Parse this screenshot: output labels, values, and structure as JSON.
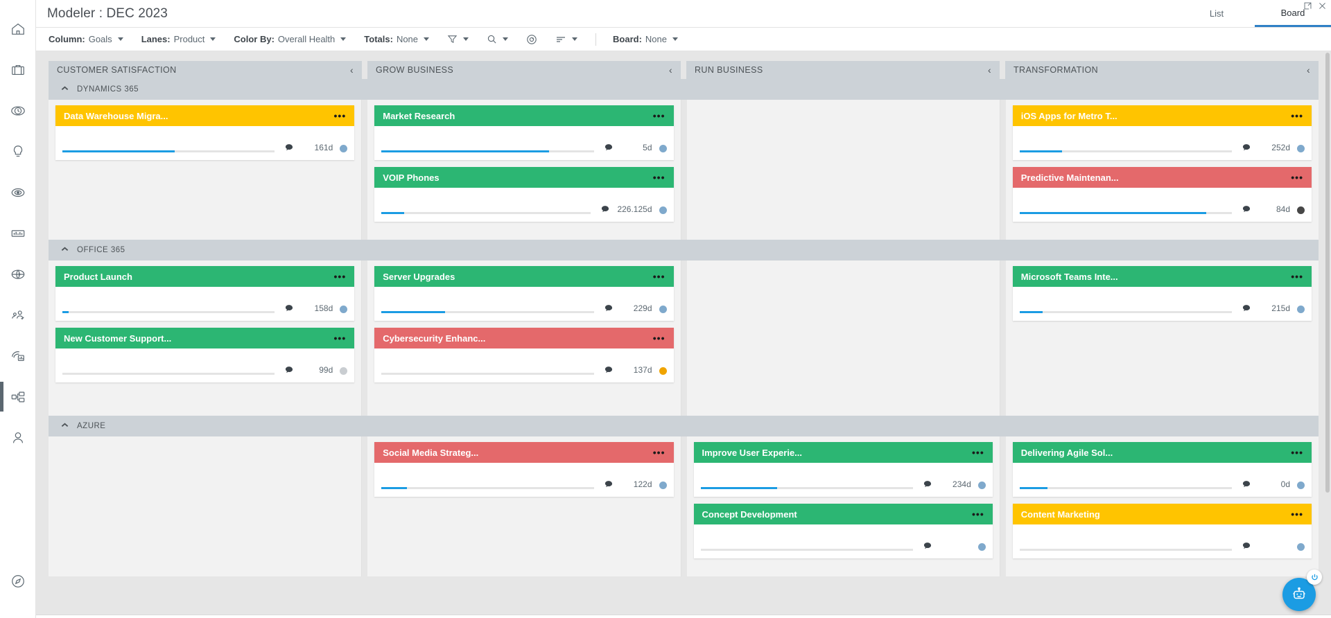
{
  "titlebar": {
    "app_title": "Modeler : DEC 2023",
    "tabs": [
      {
        "label": "List",
        "active": false
      },
      {
        "label": "Board",
        "active": true
      }
    ],
    "window_controls": [
      {
        "name": "restore-icon",
        "glyph": "❐"
      },
      {
        "name": "close-icon",
        "glyph": "✕"
      }
    ]
  },
  "toolbar": {
    "items": [
      {
        "label": "Column:",
        "value": "Goals",
        "name": "column-selector"
      },
      {
        "label": "Lanes:",
        "value": "Product",
        "name": "lanes-selector"
      },
      {
        "label": "Color By:",
        "value": "Overall Health",
        "name": "color-by-selector"
      },
      {
        "label": "Totals:",
        "value": "None",
        "name": "totals-selector"
      }
    ],
    "icon_items": [
      {
        "name": "filter-icon"
      },
      {
        "name": "search-icon"
      },
      {
        "name": "gauge-icon"
      },
      {
        "name": "sort-icon"
      }
    ],
    "board_item": {
      "label": "Board:",
      "value": "None",
      "name": "board-selector"
    }
  },
  "board": {
    "columns": [
      {
        "title": "CUSTOMER SATISFACTION"
      },
      {
        "title": "GROW BUSINESS"
      },
      {
        "title": "RUN BUSINESS"
      },
      {
        "title": "TRANSFORMATION"
      }
    ],
    "collapse_glyph": "‹",
    "lanes": [
      {
        "name": "DYNAMICS 365",
        "cells": [
          {
            "cards": [
              {
                "title": "Data Warehouse Migra...",
                "color": "#ffc400",
                "progress": 53,
                "days": "161d",
                "dot": "#7fa9cc"
              }
            ]
          },
          {
            "cards": [
              {
                "title": "Market Research",
                "color": "#2cb673",
                "progress": 79,
                "days": "5d",
                "dot": "#7fa9cc"
              },
              {
                "title": "VOIP Phones",
                "color": "#2cb673",
                "progress": 11,
                "days": "226.125d",
                "dot": "#7fa9cc"
              }
            ]
          },
          {
            "cards": []
          },
          {
            "cards": [
              {
                "title": "iOS Apps for Metro T...",
                "color": "#ffc400",
                "progress": 20,
                "days": "252d",
                "dot": "#7fa9cc"
              },
              {
                "title": "Predictive Maintenan...",
                "color": "#e4696b",
                "progress": 88,
                "days": "84d",
                "dot": "#474747"
              }
            ]
          }
        ]
      },
      {
        "name": "OFFICE 365",
        "cells": [
          {
            "cards": [
              {
                "title": "Product Launch",
                "color": "#2cb673",
                "progress": 3,
                "days": "158d",
                "dot": "#7fa9cc"
              },
              {
                "title": "New Customer Support...",
                "color": "#2cb673",
                "progress": 0,
                "days": "99d",
                "dot": "#c9cdd1"
              }
            ]
          },
          {
            "cards": [
              {
                "title": "Server Upgrades",
                "color": "#2cb673",
                "progress": 30,
                "days": "229d",
                "dot": "#7fa9cc"
              },
              {
                "title": "Cybersecurity Enhanc...",
                "color": "#e4696b",
                "progress": 0,
                "days": "137d",
                "dot": "#f0a400"
              }
            ]
          },
          {
            "cards": []
          },
          {
            "cards": [
              {
                "title": "Microsoft Teams Inte...",
                "color": "#2cb673",
                "progress": 11,
                "days": "215d",
                "dot": "#7fa9cc"
              }
            ]
          }
        ]
      },
      {
        "name": "AZURE",
        "cells": [
          {
            "cards": []
          },
          {
            "cards": [
              {
                "title": "Social Media Strateg...",
                "color": "#e4696b",
                "progress": 12,
                "days": "122d",
                "dot": "#7fa9cc"
              }
            ]
          },
          {
            "cards": [
              {
                "title": "Improve User Experie...",
                "color": "#2cb673",
                "progress": 36,
                "days": "234d",
                "dot": "#7fa9cc"
              },
              {
                "title": "Concept Development",
                "color": "#2cb673",
                "progress": 0,
                "days": "",
                "dot": "#7fa9cc"
              }
            ]
          },
          {
            "cards": [
              {
                "title": "Delivering Agile Sol...",
                "color": "#2cb673",
                "progress": 13,
                "days": "0d",
                "dot": "#7fa9cc"
              },
              {
                "title": "Content Marketing",
                "color": "#ffc400",
                "progress": 0,
                "days": "",
                "dot": "#7fa9cc"
              }
            ]
          }
        ]
      }
    ]
  },
  "rail": {
    "items": [
      {
        "name": "home-icon",
        "active": false
      },
      {
        "name": "briefcase-icon",
        "active": false
      },
      {
        "name": "clock-icon",
        "active": false
      },
      {
        "name": "lightbulb-icon",
        "active": false
      },
      {
        "name": "target-icon",
        "active": false
      },
      {
        "name": "chart-icon",
        "active": false
      },
      {
        "name": "globe-icon",
        "active": false
      },
      {
        "name": "people-icon",
        "active": false
      },
      {
        "name": "report-icon",
        "active": false
      },
      {
        "name": "modeler-icon",
        "active": true
      },
      {
        "name": "person-icon",
        "active": false
      }
    ],
    "bottom": {
      "name": "compass-icon"
    }
  },
  "floating": {
    "assistant": {
      "name": "robot-assistant-button",
      "glyph": "⬚"
    },
    "power": {
      "name": "power-button",
      "glyph": "⏻"
    }
  },
  "colors": {
    "accent": "#1b9ce3",
    "green": "#2cb673",
    "yellow": "#ffc400",
    "red": "#e4696b",
    "header_gray": "#ccd2d7"
  }
}
